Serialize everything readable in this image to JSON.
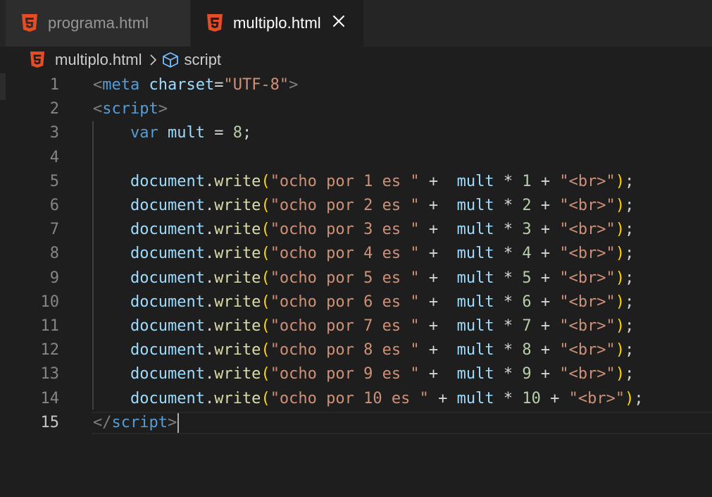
{
  "tabs": [
    {
      "label": "programa.html",
      "active": false,
      "icon": "html5-icon"
    },
    {
      "label": "multiplo.html",
      "active": true,
      "icon": "html5-icon",
      "close_icon": "close-icon"
    }
  ],
  "breadcrumb": {
    "file": "multiplo.html",
    "symbol": "script",
    "separator_icon": "chevron-right-icon",
    "symbol_icon": "cube-icon"
  },
  "editor": {
    "active_line": 15,
    "lines": [
      {
        "n": "1",
        "tokens": [
          [
            "punc",
            "<"
          ],
          [
            "tag",
            "meta"
          ],
          [
            "op",
            " "
          ],
          [
            "attr",
            "charset"
          ],
          [
            "op",
            "="
          ],
          [
            "str",
            "\"UTF-8\""
          ],
          [
            "punc",
            ">"
          ]
        ]
      },
      {
        "n": "2",
        "tokens": [
          [
            "punc",
            "<"
          ],
          [
            "tag",
            "script"
          ],
          [
            "punc",
            ">"
          ]
        ]
      },
      {
        "n": "3",
        "tokens": [
          [
            "op",
            "    "
          ],
          [
            "kw",
            "var"
          ],
          [
            "op",
            " "
          ],
          [
            "var",
            "mult"
          ],
          [
            "op",
            " = "
          ],
          [
            "num",
            "8"
          ],
          [
            "op",
            ";"
          ]
        ]
      },
      {
        "n": "4",
        "tokens": []
      },
      {
        "n": "5",
        "tokens": [
          [
            "op",
            "    "
          ],
          [
            "var",
            "document"
          ],
          [
            "op",
            "."
          ],
          [
            "fn",
            "write"
          ],
          [
            "brk",
            "("
          ],
          [
            "str",
            "\"ocho por 1 es \""
          ],
          [
            "op",
            " +  "
          ],
          [
            "var",
            "mult"
          ],
          [
            "op",
            " * "
          ],
          [
            "num",
            "1"
          ],
          [
            "op",
            " + "
          ],
          [
            "str",
            "\"<br>\""
          ],
          [
            "brk",
            ")"
          ],
          [
            "op",
            ";"
          ]
        ]
      },
      {
        "n": "6",
        "tokens": [
          [
            "op",
            "    "
          ],
          [
            "var",
            "document"
          ],
          [
            "op",
            "."
          ],
          [
            "fn",
            "write"
          ],
          [
            "brk",
            "("
          ],
          [
            "str",
            "\"ocho por 2 es \""
          ],
          [
            "op",
            " +  "
          ],
          [
            "var",
            "mult"
          ],
          [
            "op",
            " * "
          ],
          [
            "num",
            "2"
          ],
          [
            "op",
            " + "
          ],
          [
            "str",
            "\"<br>\""
          ],
          [
            "brk",
            ")"
          ],
          [
            "op",
            ";"
          ]
        ]
      },
      {
        "n": "7",
        "tokens": [
          [
            "op",
            "    "
          ],
          [
            "var",
            "document"
          ],
          [
            "op",
            "."
          ],
          [
            "fn",
            "write"
          ],
          [
            "brk",
            "("
          ],
          [
            "str",
            "\"ocho por 3 es \""
          ],
          [
            "op",
            " +  "
          ],
          [
            "var",
            "mult"
          ],
          [
            "op",
            " * "
          ],
          [
            "num",
            "3"
          ],
          [
            "op",
            " + "
          ],
          [
            "str",
            "\"<br>\""
          ],
          [
            "brk",
            ")"
          ],
          [
            "op",
            ";"
          ]
        ]
      },
      {
        "n": "8",
        "tokens": [
          [
            "op",
            "    "
          ],
          [
            "var",
            "document"
          ],
          [
            "op",
            "."
          ],
          [
            "fn",
            "write"
          ],
          [
            "brk",
            "("
          ],
          [
            "str",
            "\"ocho por 4 es \""
          ],
          [
            "op",
            " +  "
          ],
          [
            "var",
            "mult"
          ],
          [
            "op",
            " * "
          ],
          [
            "num",
            "4"
          ],
          [
            "op",
            " + "
          ],
          [
            "str",
            "\"<br>\""
          ],
          [
            "brk",
            ")"
          ],
          [
            "op",
            ";"
          ]
        ]
      },
      {
        "n": "9",
        "tokens": [
          [
            "op",
            "    "
          ],
          [
            "var",
            "document"
          ],
          [
            "op",
            "."
          ],
          [
            "fn",
            "write"
          ],
          [
            "brk",
            "("
          ],
          [
            "str",
            "\"ocho por 5 es \""
          ],
          [
            "op",
            " +  "
          ],
          [
            "var",
            "mult"
          ],
          [
            "op",
            " * "
          ],
          [
            "num",
            "5"
          ],
          [
            "op",
            " + "
          ],
          [
            "str",
            "\"<br>\""
          ],
          [
            "brk",
            ")"
          ],
          [
            "op",
            ";"
          ]
        ]
      },
      {
        "n": "10",
        "tokens": [
          [
            "op",
            "    "
          ],
          [
            "var",
            "document"
          ],
          [
            "op",
            "."
          ],
          [
            "fn",
            "write"
          ],
          [
            "brk",
            "("
          ],
          [
            "str",
            "\"ocho por 6 es \""
          ],
          [
            "op",
            " +  "
          ],
          [
            "var",
            "mult"
          ],
          [
            "op",
            " * "
          ],
          [
            "num",
            "6"
          ],
          [
            "op",
            " + "
          ],
          [
            "str",
            "\"<br>\""
          ],
          [
            "brk",
            ")"
          ],
          [
            "op",
            ";"
          ]
        ]
      },
      {
        "n": "11",
        "tokens": [
          [
            "op",
            "    "
          ],
          [
            "var",
            "document"
          ],
          [
            "op",
            "."
          ],
          [
            "fn",
            "write"
          ],
          [
            "brk",
            "("
          ],
          [
            "str",
            "\"ocho por 7 es \""
          ],
          [
            "op",
            " +  "
          ],
          [
            "var",
            "mult"
          ],
          [
            "op",
            " * "
          ],
          [
            "num",
            "7"
          ],
          [
            "op",
            " + "
          ],
          [
            "str",
            "\"<br>\""
          ],
          [
            "brk",
            ")"
          ],
          [
            "op",
            ";"
          ]
        ]
      },
      {
        "n": "12",
        "tokens": [
          [
            "op",
            "    "
          ],
          [
            "var",
            "document"
          ],
          [
            "op",
            "."
          ],
          [
            "fn",
            "write"
          ],
          [
            "brk",
            "("
          ],
          [
            "str",
            "\"ocho por 8 es \""
          ],
          [
            "op",
            " +  "
          ],
          [
            "var",
            "mult"
          ],
          [
            "op",
            " * "
          ],
          [
            "num",
            "8"
          ],
          [
            "op",
            " + "
          ],
          [
            "str",
            "\"<br>\""
          ],
          [
            "brk",
            ")"
          ],
          [
            "op",
            ";"
          ]
        ]
      },
      {
        "n": "13",
        "tokens": [
          [
            "op",
            "    "
          ],
          [
            "var",
            "document"
          ],
          [
            "op",
            "."
          ],
          [
            "fn",
            "write"
          ],
          [
            "brk",
            "("
          ],
          [
            "str",
            "\"ocho por 9 es \""
          ],
          [
            "op",
            " +  "
          ],
          [
            "var",
            "mult"
          ],
          [
            "op",
            " * "
          ],
          [
            "num",
            "9"
          ],
          [
            "op",
            " + "
          ],
          [
            "str",
            "\"<br>\""
          ],
          [
            "brk",
            ")"
          ],
          [
            "op",
            ";"
          ]
        ]
      },
      {
        "n": "14",
        "tokens": [
          [
            "op",
            "    "
          ],
          [
            "var",
            "document"
          ],
          [
            "op",
            "."
          ],
          [
            "fn",
            "write"
          ],
          [
            "brk",
            "("
          ],
          [
            "str",
            "\"ocho por 10 es \""
          ],
          [
            "op",
            " + "
          ],
          [
            "var",
            "mult"
          ],
          [
            "op",
            " * "
          ],
          [
            "num",
            "10"
          ],
          [
            "op",
            " + "
          ],
          [
            "str",
            "\"<br>\""
          ],
          [
            "brk",
            ")"
          ],
          [
            "op",
            ";"
          ]
        ]
      },
      {
        "n": "15",
        "tokens": [
          [
            "punc",
            "</"
          ],
          [
            "tag",
            "script"
          ],
          [
            "punc",
            ">"
          ]
        ]
      }
    ]
  },
  "colors": {
    "background": "#1e1e1e",
    "tab_inactive": "#2d2d2d",
    "tabbar": "#252526",
    "html5_orange": "#e44d26",
    "tag_blue": "#569cd6",
    "string": "#ce9178",
    "function": "#dcdcaa",
    "variable": "#9cdcfe",
    "number": "#b5cea8",
    "bracket": "#ffd700"
  }
}
